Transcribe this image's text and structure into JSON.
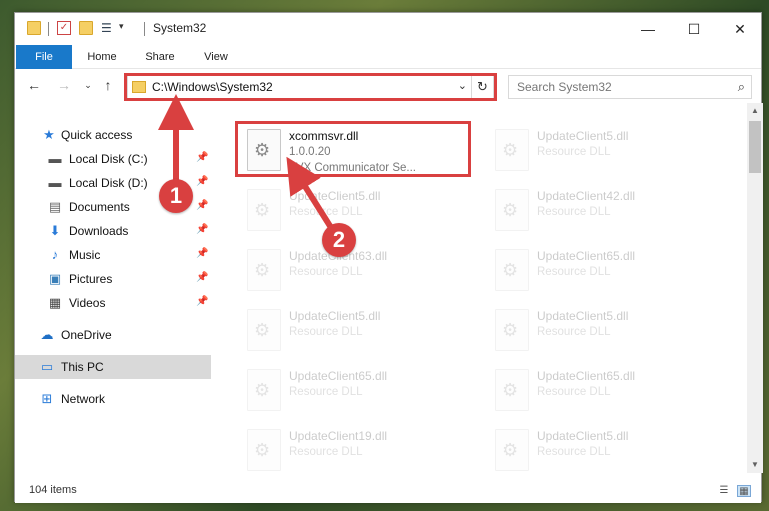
{
  "window": {
    "title": "System32",
    "controls": {
      "minimize": "—",
      "maximize": "☐",
      "close": "✕"
    }
  },
  "ribbon": {
    "tabs": [
      {
        "label": "File"
      },
      {
        "label": "Home"
      },
      {
        "label": "Share"
      },
      {
        "label": "View"
      }
    ]
  },
  "address": {
    "path": "C:\\Windows\\System32"
  },
  "search": {
    "placeholder": "Search System32"
  },
  "nav": {
    "items": [
      {
        "label": "Quick access"
      },
      {
        "label": "Local Disk (C:)"
      },
      {
        "label": "Local Disk (D:)"
      },
      {
        "label": "Documents"
      },
      {
        "label": "Downloads"
      },
      {
        "label": "Music"
      },
      {
        "label": "Pictures"
      },
      {
        "label": "Videos"
      },
      {
        "label": "OneDrive"
      },
      {
        "label": "This PC"
      },
      {
        "label": "Network"
      }
    ]
  },
  "files": [
    {
      "name": "xcommsvr.dll",
      "version": "1.0.0.20",
      "desc": "AVX Communicator Se..."
    },
    {
      "name": "UpdateClient5.dll",
      "desc": "Resource DLL"
    },
    {
      "name": "UpdateClient5.dll",
      "desc": "Resource DLL"
    },
    {
      "name": "UpdateClient42.dll",
      "desc": "Resource DLL"
    },
    {
      "name": "UpdateClient63.dll",
      "desc": "Resource DLL"
    },
    {
      "name": "UpdateClient65.dll",
      "desc": "Resource DLL"
    },
    {
      "name": "UpdateClient5.dll",
      "desc": "Resource DLL"
    },
    {
      "name": "UpdateClient5.dll",
      "desc": "Resource DLL"
    },
    {
      "name": "UpdateClient65.dll",
      "desc": "Resource DLL"
    },
    {
      "name": "UpdateClient65.dll",
      "desc": "Resource DLL"
    },
    {
      "name": "UpdateClient19.dll",
      "desc": "Resource DLL"
    },
    {
      "name": "UpdateClient5.dll",
      "desc": "Resource DLL"
    }
  ],
  "status": {
    "items_count": "104 items"
  },
  "annotations": {
    "step1": "1",
    "step2": "2",
    "color": "#d94040"
  }
}
